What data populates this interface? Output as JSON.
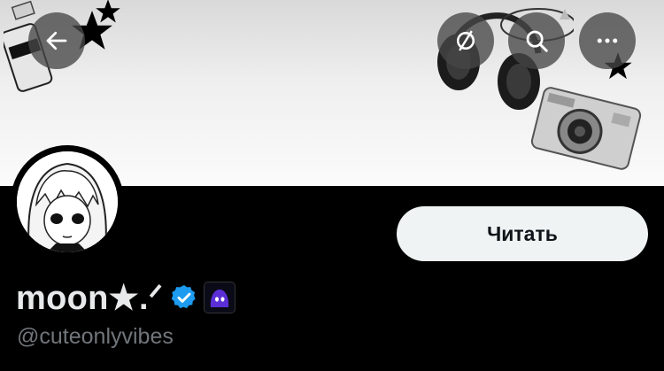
{
  "profile": {
    "display_name": "moon★.ᐟ",
    "handle": "@cuteonlyvibes",
    "verified": true
  },
  "actions": {
    "follow_label": "Читать"
  },
  "header": {
    "buttons": [
      "back-arrow-icon",
      "no-translate-icon",
      "search-icon",
      "more-icon"
    ]
  },
  "colors": {
    "background": "#000000",
    "follow_button_bg": "#eff3f4",
    "verified_badge": "#1d9bf0",
    "handle_text": "#71767b",
    "overlay_button": "#464646"
  }
}
